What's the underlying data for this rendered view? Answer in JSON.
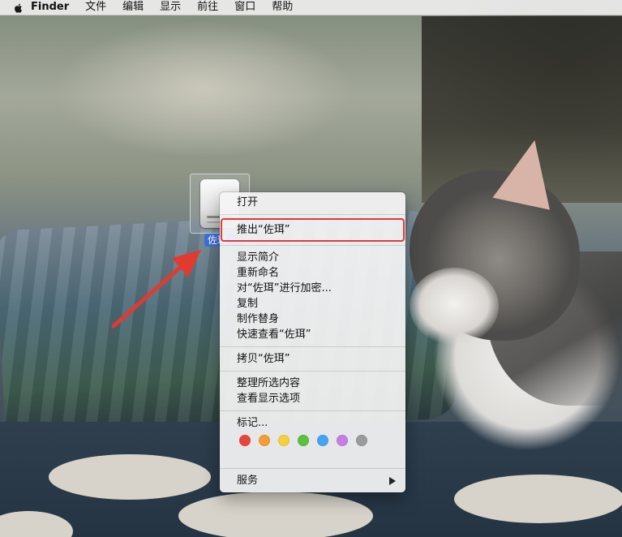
{
  "menubar": {
    "app_name": "Finder",
    "items": [
      "文件",
      "编辑",
      "显示",
      "前往",
      "窗口",
      "帮助"
    ]
  },
  "desktop": {
    "drive_label": "佐珥"
  },
  "context_menu": {
    "open": "打开",
    "eject": "推出“佐珥”",
    "get_info": "显示简介",
    "rename": "重新命名",
    "encrypt": "对“佐珥”进行加密...",
    "duplicate": "复制",
    "make_alias": "制作替身",
    "quick_look": "快速查看“佐珥”",
    "copy": "拷贝“佐珥”",
    "clean_up": "整理所选内容",
    "show_view_options": "查看显示选项",
    "tags": "标记...",
    "tag_colors": [
      "#e8463b",
      "#f29d38",
      "#f5cf3c",
      "#5cc13f",
      "#44a4f2",
      "#c57ee2",
      "#9b9b9b"
    ],
    "services": "服务"
  },
  "annotation": {
    "arrow_color": "#e23a2f",
    "highlight_color": "#e0393e"
  }
}
